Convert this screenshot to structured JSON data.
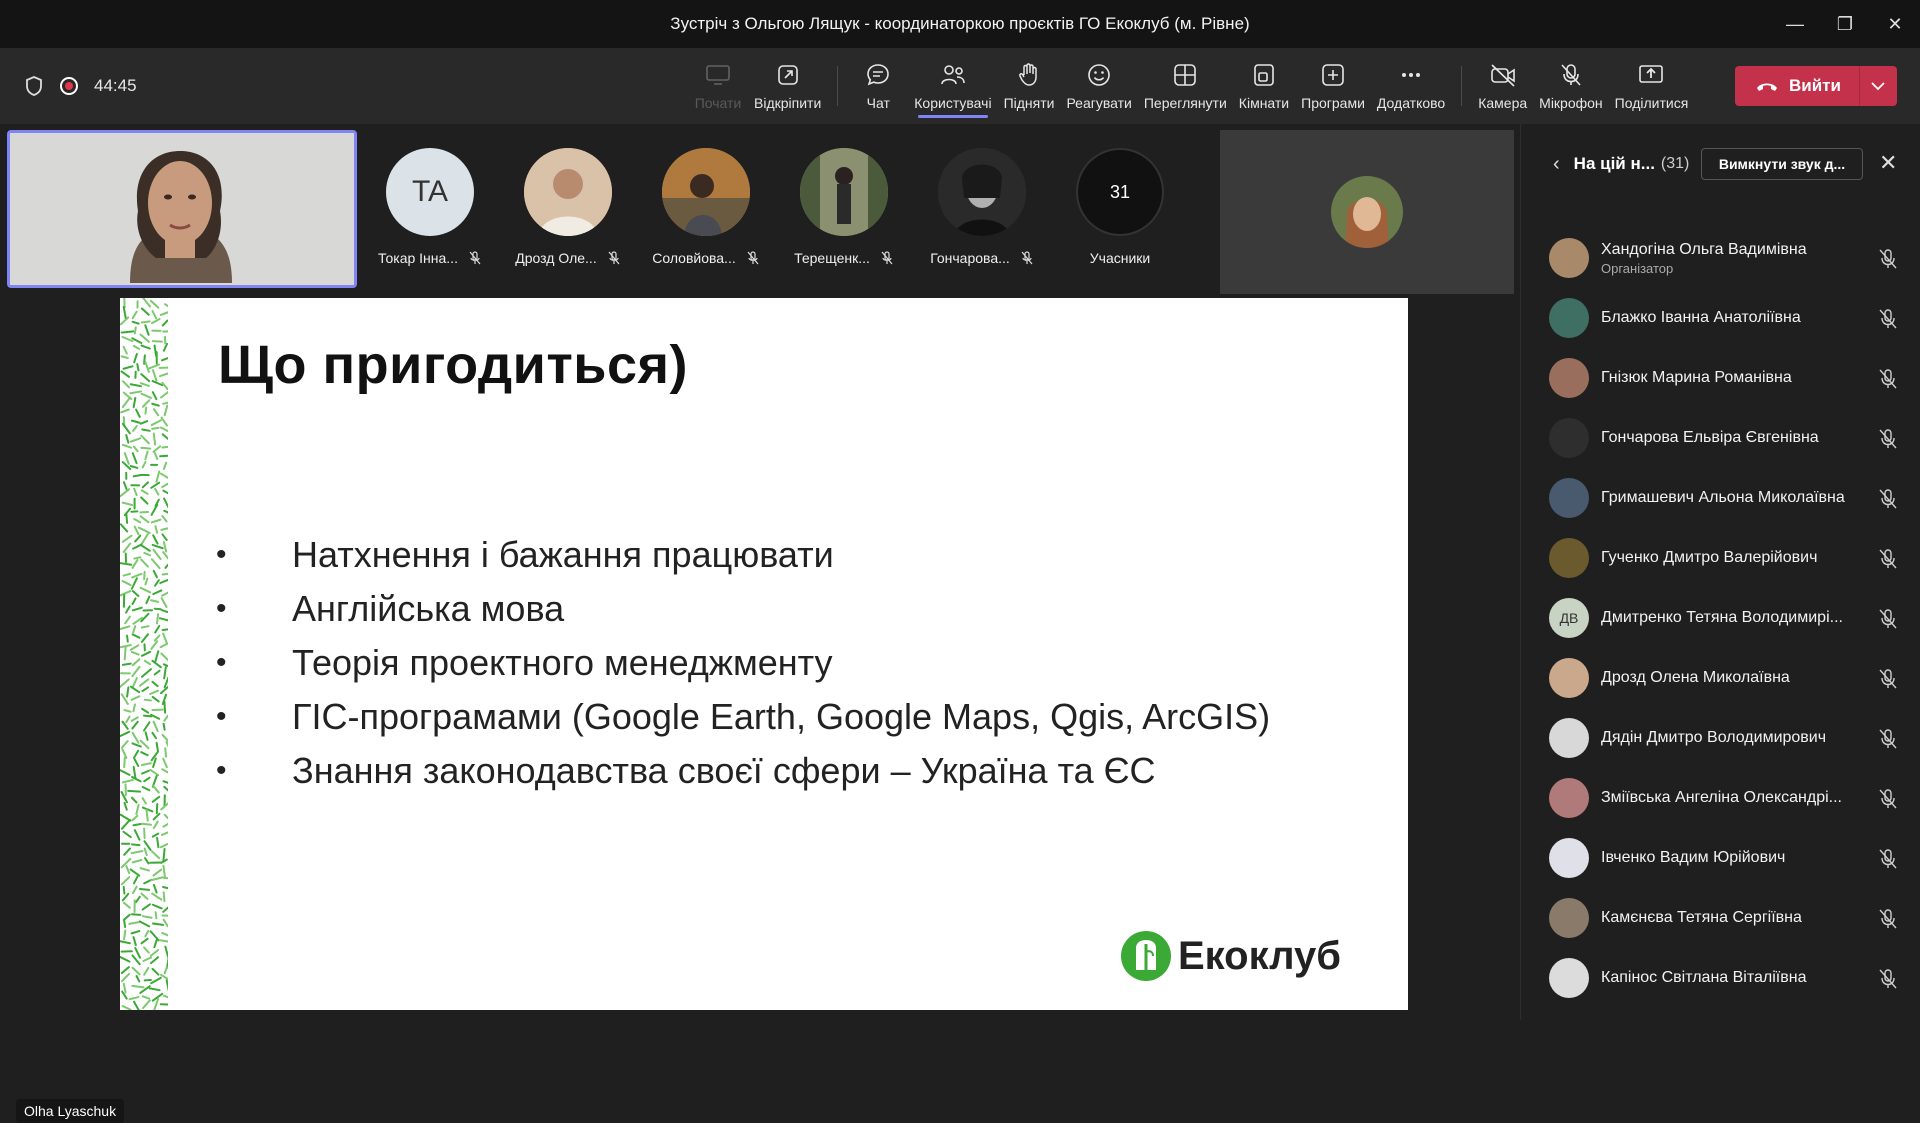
{
  "window": {
    "title": "Зустріч з Ольгою Лящук - координаторкою проєктів ГО Екоклуб (м. Рівне)",
    "minimize": "—",
    "restore": "❐",
    "close": "✕"
  },
  "toolbar": {
    "timer": "44:45",
    "items": [
      {
        "label": "Почати",
        "icon": "share-screen-icon",
        "disabled": true
      },
      {
        "label": "Відкріпити",
        "icon": "popout-icon"
      },
      {
        "label": "Чат",
        "icon": "chat-icon"
      },
      {
        "label": "Користувачі",
        "icon": "people-icon",
        "active": true
      },
      {
        "label": "Підняти",
        "icon": "raise-hand-icon"
      },
      {
        "label": "Реагувати",
        "icon": "smile-icon"
      },
      {
        "label": "Переглянути",
        "icon": "view-icon"
      },
      {
        "label": "Кімнати",
        "icon": "rooms-icon"
      },
      {
        "label": "Програми",
        "icon": "apps-icon"
      },
      {
        "label": "Додатково",
        "icon": "more-icon"
      },
      {
        "label": "Камера",
        "icon": "camera-off-icon"
      },
      {
        "label": "Мікрофон",
        "icon": "mic-off-icon"
      },
      {
        "label": "Поділитися",
        "icon": "share-icon"
      }
    ],
    "leave_label": "Вийти"
  },
  "strip": {
    "participants": [
      {
        "name": "Токар Інна...",
        "initials": "TA",
        "bg": "#dbe3e8"
      },
      {
        "name": "Дрозд Оле...",
        "bg": "#c9a88c"
      },
      {
        "name": "Соловйова...",
        "bg": "#b08a5b"
      },
      {
        "name": "Терещенк...",
        "bg": "#7d8a6a"
      },
      {
        "name": "Гончарова...",
        "bg": "#3d3d3d"
      }
    ],
    "count": "31",
    "count_label": "Учасники"
  },
  "slide": {
    "title": "Що пригодиться)",
    "bullets": [
      "Натхнення і бажання працювати",
      "Англійська мова",
      "Теорія проектного менеджменту",
      "ГІС-програмами (Google Earth, Google Maps, Qgis, ArcGIS)",
      "Знання законодавства своєї сфери – Україна та ЄС"
    ],
    "bullet_char": "•",
    "brand": "Екоклуб",
    "brand_color": "#3aa935"
  },
  "presenter_name": "Olha Lyaschuk",
  "panel": {
    "title": "На цій н...",
    "count": "(31)",
    "mute_all": "Вимкнути звук д...",
    "participants": [
      {
        "name": "Хандогіна Ольга Вадимівна",
        "role": "Організатор",
        "bg": "#a88a6a"
      },
      {
        "name": "Блажко Іванна Анатоліївна",
        "bg": "#3f6f63"
      },
      {
        "name": "Гнізюк Марина Романівна",
        "bg": "#9a6e5c"
      },
      {
        "name": "Гончарова Ельвіра Євгенівна",
        "bg": "#2e2e2e"
      },
      {
        "name": "Гримашевич Альона Миколаївна",
        "bg": "#4a5a6e"
      },
      {
        "name": "Гученко Дмитро Валерійович",
        "bg": "#6a5a2e"
      },
      {
        "name": "Дмитренко Тетяна Володимирі...",
        "initials": "ДВ",
        "bg": "#c9d3c3"
      },
      {
        "name": "Дрозд Олена Миколаївна",
        "bg": "#c9a88c"
      },
      {
        "name": "Дядін Дмитро Володимирович",
        "bg": "#d8d8d8"
      },
      {
        "name": "Зміївська Ангеліна Олександрі...",
        "bg": "#b07a7a"
      },
      {
        "name": "Івченко Вадим Юрійович",
        "bg": "#e0e0e8"
      },
      {
        "name": "Камєнєва Тетяна Сергіївна",
        "bg": "#8a7a6a"
      },
      {
        "name": "Капінос Світлана Віталіївна",
        "bg": "#dcdcdc"
      }
    ]
  },
  "colors": {
    "accent": "#7f85f5",
    "leave": "#c4314b",
    "record": "#e0364a"
  }
}
